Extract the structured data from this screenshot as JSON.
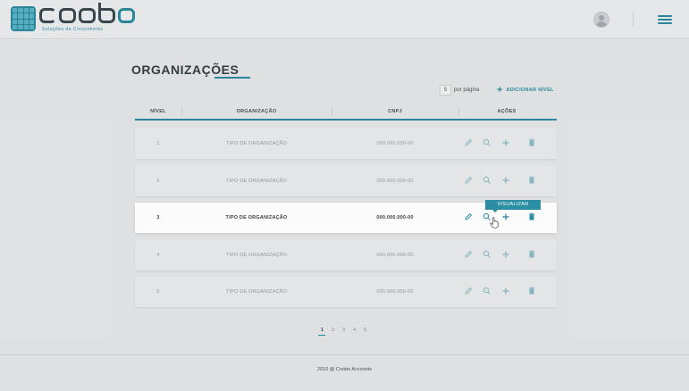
{
  "header": {
    "brand": "Coobo",
    "tagline": "Soluções de Crescimento",
    "colors": {
      "accent": "#2b8ea3",
      "logo_dark": "#3e4b53"
    }
  },
  "page": {
    "title": "ORGANIZAÇÕES"
  },
  "controls": {
    "per_page_value": "5",
    "per_page_label": "por página",
    "add_level_label": "ADICIONAR NÍVEL"
  },
  "table": {
    "columns": [
      "NÍVEL",
      "ORGANIZAÇÃO",
      "CNPJ",
      "AÇÕES"
    ],
    "rows": [
      {
        "nivel": "1",
        "organizacao": "TIPO DE ORGANIZAÇÃO",
        "cnpj": "000.000.000-00"
      },
      {
        "nivel": "2",
        "organizacao": "TIPO DE ORGANIZAÇÃO",
        "cnpj": "000.000.000-00"
      },
      {
        "nivel": "3",
        "organizacao": "TIPO DE ORGANIZAÇÃO",
        "cnpj": "000.000.000-00"
      },
      {
        "nivel": "4",
        "organizacao": "TIPO DE ORGANIZAÇÃO",
        "cnpj": "000.000.000-00"
      },
      {
        "nivel": "5",
        "organizacao": "TIPO DE ORGANIZAÇÃO",
        "cnpj": "000.000.000-00"
      }
    ],
    "actions": [
      "edit-icon",
      "search-icon",
      "plus-icon",
      "trash-icon"
    ],
    "tooltip": "VISUALIZAR"
  },
  "pagination": {
    "pages": [
      "1",
      "2",
      "3",
      "4",
      "5"
    ],
    "current": "1"
  },
  "footer": {
    "text": "2016 @ Coobo Accounts"
  }
}
